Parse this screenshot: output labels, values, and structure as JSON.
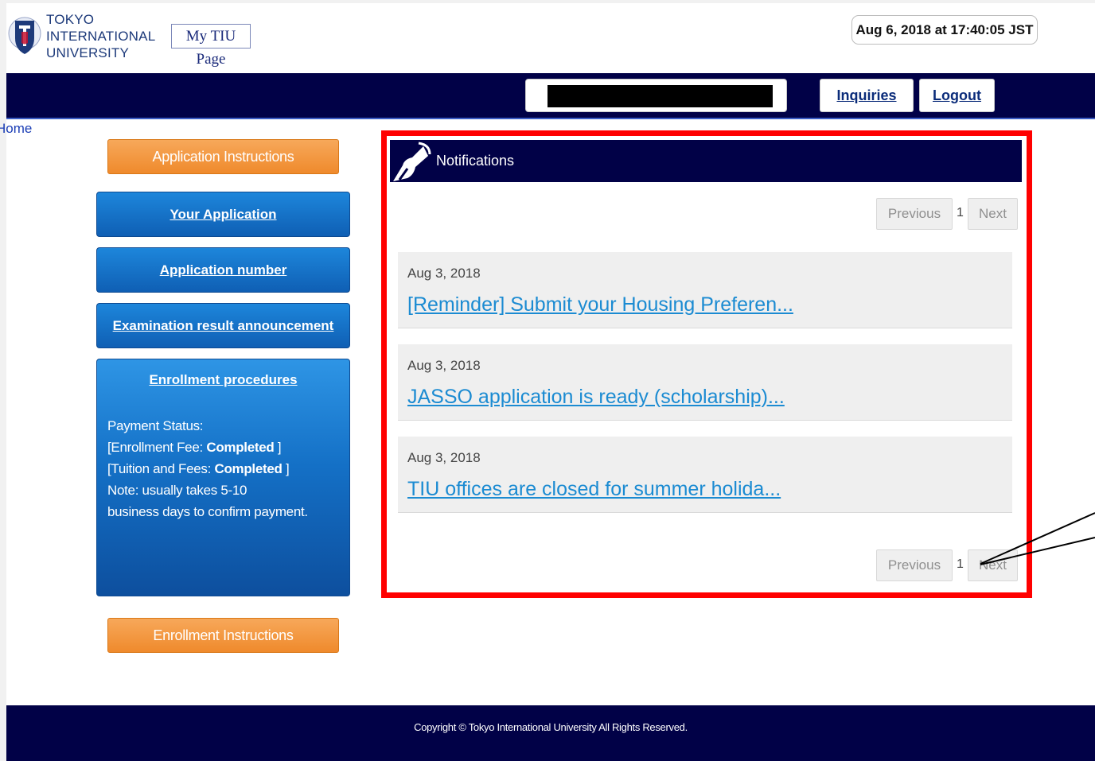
{
  "header": {
    "logo_lines": [
      "TOKYO",
      "INTERNATIONAL",
      "UNIVERSITY"
    ],
    "my_page_label": "My TIU Page",
    "datetime": "Aug 6, 2018 at 17:40:05 JST"
  },
  "nav": {
    "inquiries_label": "Inquiries",
    "logout_label": "Logout",
    "breadcrumb": "Home"
  },
  "sidebar": {
    "application_instructions": "Application Instructions",
    "your_application": "Your Application",
    "application_number": "Application number",
    "examination_result": "Examination result announcement",
    "enrollment_procedures": "Enrollment procedures",
    "payment": {
      "status_label": "Payment Status:",
      "fee_prefix": "[Enrollment Fee: ",
      "fee_value": "Completed",
      "fee_suffix": " ]",
      "tuition_prefix": "[Tuition and Fees: ",
      "tuition_value": "Completed",
      "tuition_suffix": " ]",
      "note_line1": "Note: usually takes 5-10",
      "note_line2": "business days to confirm payment."
    },
    "enrollment_instructions": "Enrollment Instructions"
  },
  "notifications": {
    "title": "Notifications",
    "pagination": {
      "previous": "Previous",
      "page": "1",
      "next": "Next"
    },
    "items": [
      {
        "date": "Aug 3, 2018",
        "title": "[Reminder] Submit your Housing Preferen..."
      },
      {
        "date": "Aug 3, 2018",
        "title": "JASSO application is ready (scholarship)..."
      },
      {
        "date": "Aug 3, 2018",
        "title": "TIU offices are closed for summer holida..."
      }
    ]
  },
  "footer": {
    "copyright": "Copyright © Tokyo International University All Rights Reserved."
  },
  "colors": {
    "navy": "#010147",
    "orange": "#f39237",
    "blue": "#1570c8",
    "link": "#1b8bd2",
    "highlight": "#ff0000"
  }
}
